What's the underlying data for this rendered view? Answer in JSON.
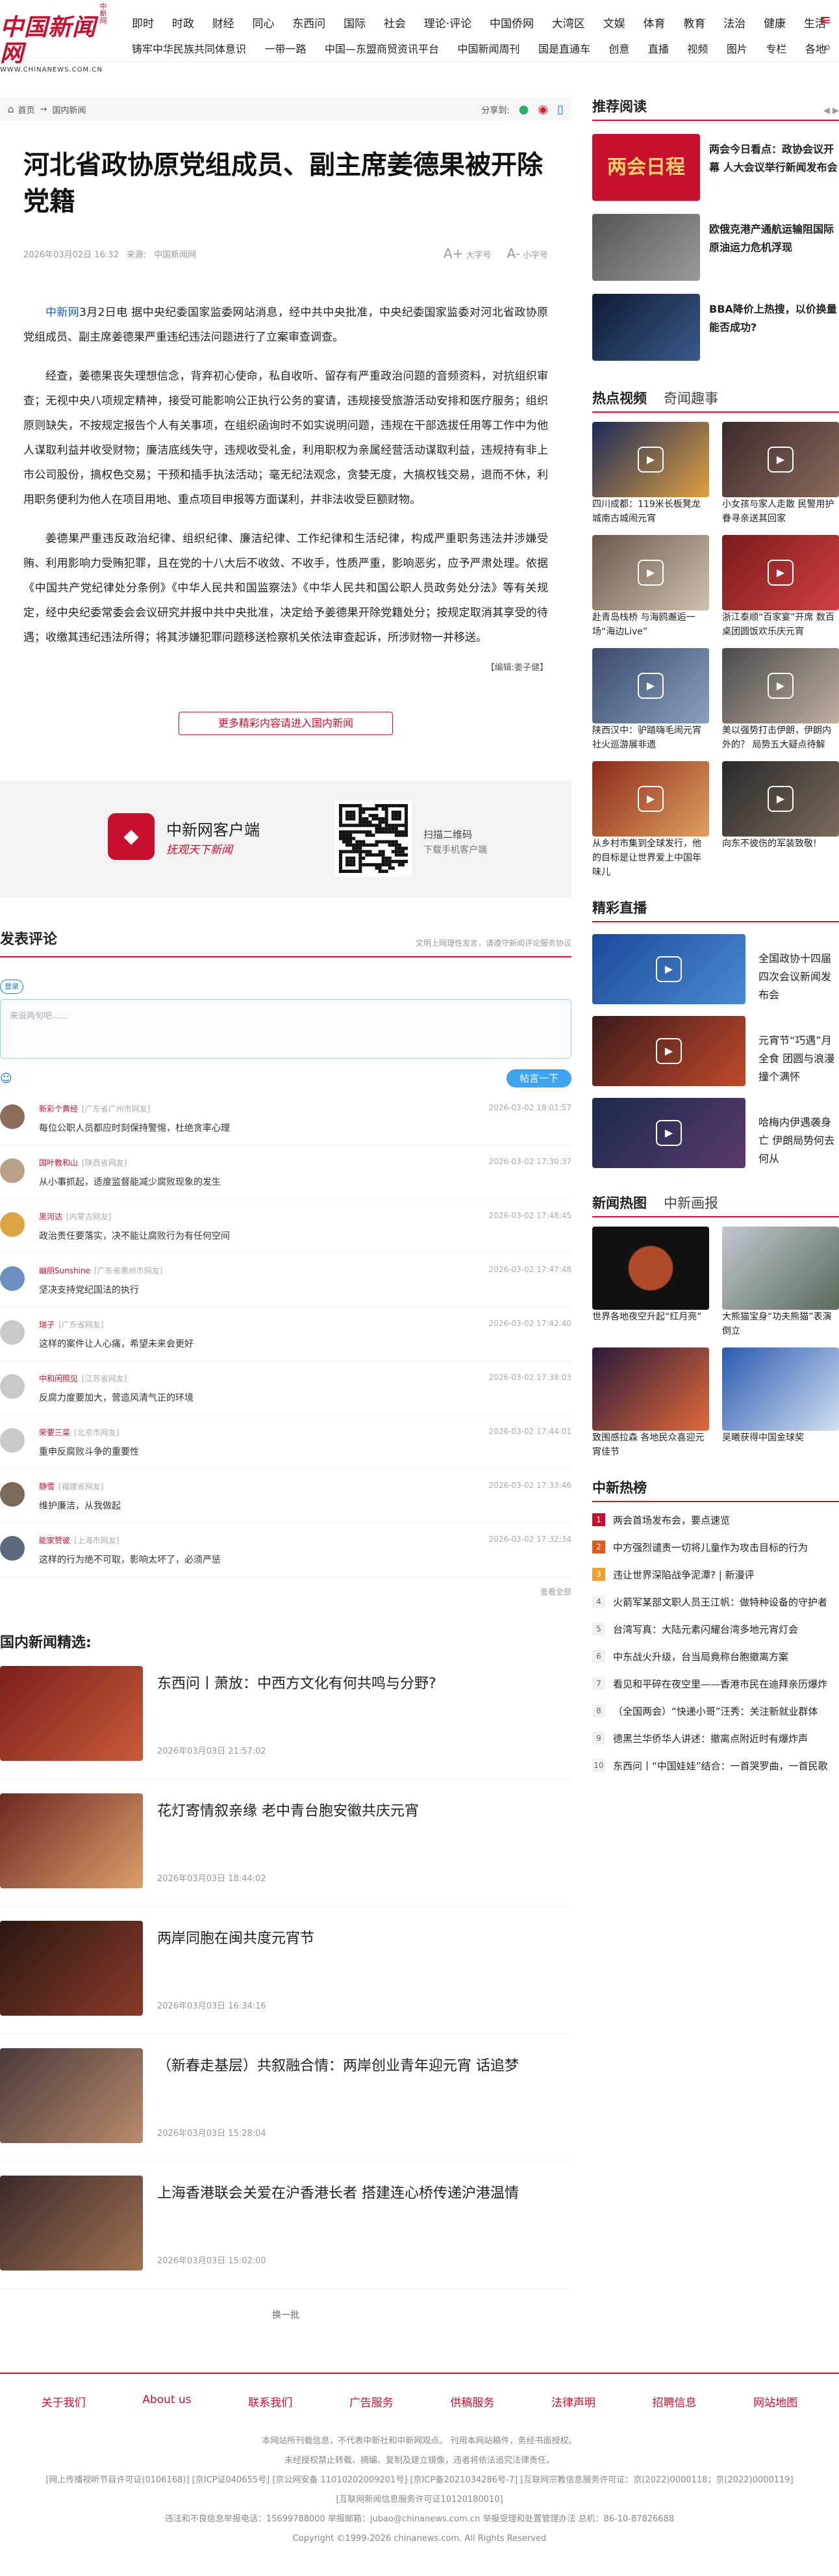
{
  "logo": {
    "cn": "中国新闻网",
    "en": "WWW.CHINANEWS.COM.CN",
    "sub": "中新网"
  },
  "nav": {
    "row1": [
      "即时",
      "时政",
      "财经",
      "国际",
      "社会",
      "理论·评论",
      "中国侨网",
      "大湾区",
      "文娱",
      "体育",
      "教育",
      "法治",
      "健康",
      "生活"
    ],
    "row2": [
      "铸牢中华民族共同体意识",
      "一带一路",
      "中国—东盟商贸资讯平台",
      "中国新闻周刊",
      "国是直通车",
      "创意",
      "直播",
      "视频",
      "图片",
      "专栏",
      "各地"
    ],
    "row1_special": "同心",
    "row1_special2": "东西问"
  },
  "crumb": {
    "home": "首页",
    "section": "国内新闻",
    "share_label": "分享到:"
  },
  "article": {
    "title": "河北省政协原党组成员、副主席姜德果被开除党籍",
    "date": "2026年03月02日 16:32",
    "source_label": "来源:",
    "source": "中国新闻网",
    "font_big": "大字号",
    "font_small": "小字号",
    "p1_src": "中新网",
    "p1": "3月2日电 据中央纪委国家监委网站消息，经中共中央批准，中央纪委国家监委对河北省政协原党组成员、副主席姜德果严重违纪违法问题进行了立案审查调查。",
    "p2": "经查，姜德果丧失理想信念，背弃初心使命，私自收听、留存有严重政治问题的音频资料，对抗组织审查；无视中央八项规定精神，接受可能影响公正执行公务的宴请，违规接受旅游活动安排和医疗服务；组织原则缺失，不按规定报告个人有关事项，在组织函询时不如实说明问题，违规在干部选拔任用等工作中为他人谋取利益并收受财物；廉洁底线失守，违规收受礼金，利用职权为亲属经营活动谋取利益，违规持有非上市公司股份，搞权色交易；干预和插手执法活动；毫无纪法观念，贪婪无度，大搞权钱交易，退而不休，利用职务便利为他人在项目用地、重点项目申报等方面谋利，并非法收受巨额财物。",
    "p3": "姜德果严重违反政治纪律、组织纪律、廉洁纪律、工作纪律和生活纪律，构成严重职务违法并涉嫌受贿、利用影响力受贿犯罪，且在党的十八大后不收敛、不收手，性质严重，影响恶劣，应予严肃处理。依据《中国共产党纪律处分条例》《中华人民共和国监察法》《中华人民共和国公职人员政务处分法》等有关规定，经中央纪委常委会会议研究并报中共中央批准，决定给予姜德果开除党籍处分；按规定取消其享受的待遇；收缴其违纪违法所得；将其涉嫌犯罪问题移送检察机关依法审查起诉，所涉财物一并移送。",
    "editor": "【编辑:姜子健】",
    "more": "更多精彩内容请进入国内新闻"
  },
  "app": {
    "name": "中新网客户端",
    "slogan": "抚观天下新闻",
    "scan1": "扫描二维码",
    "scan2": "下载手机客户端"
  },
  "comments": {
    "title": "发表评论",
    "note": "文明上网理性发言，请遵守新闻评论服务协议",
    "login": "登录",
    "placeholder": "来说两句吧......",
    "post": "帖言一下",
    "more": "查看全部",
    "items": [
      {
        "name": "新彩个黄经",
        "loc": "[广东省广州市网友]",
        "time": "2026-03-02 18:01:57",
        "text": "每位公职人员都应时刻保持警惕，杜绝贪率心理"
      },
      {
        "name": "国叶教和山",
        "loc": "[陕西省网友]",
        "time": "2026-03-02 17:30:37",
        "text": "从小事抓起，适度监督能减少腐败现象的发生"
      },
      {
        "name": "黑河达",
        "loc": "[内蒙古网友]",
        "time": "2026-03-02 17:48:45",
        "text": "政治责任要落实，决不能让腐败行为有任何空间"
      },
      {
        "name": "幽丽Sunshine",
        "loc": "[广东省惠州市网友]",
        "time": "2026-03-02 17:47:48",
        "text": "坚决支持党纪国法的执行"
      },
      {
        "name": "瑞子",
        "loc": "[广东省网友]",
        "time": "2026-03-02 17:42:40",
        "text": "这样的案件让人心痛，希望未来会更好"
      },
      {
        "name": "中和闲照见",
        "loc": "[江苏省网友]",
        "time": "2026-03-02 17:38:03",
        "text": "反腐力度要加大，营造风清气正的环境"
      },
      {
        "name": "荣要三菜",
        "loc": "[北京市网友]",
        "time": "2026-03-02 17:44:01",
        "text": "重申反腐败斗争的重要性"
      },
      {
        "name": "静雪",
        "loc": "[福建省网友]",
        "time": "2026-03-02 17:33:46",
        "text": "维护廉洁，从我做起"
      },
      {
        "name": "能家赞彼",
        "loc": "[上海市网友]",
        "time": "2026-03-02 17:32:34",
        "text": "这样的行为绝不可取，影响太坏了，必须严惩"
      }
    ]
  },
  "selection": {
    "title": "国内新闻精选:",
    "huanyipi": "换一批",
    "items": [
      {
        "title": "东西问丨萧放：中西方文化有何共鸣与分野?",
        "time": "2026年03月03日 21:57:02"
      },
      {
        "title": "花灯寄情叙亲缘 老中青台胞安徽共庆元宵",
        "time": "2026年03月03日 18:44:02"
      },
      {
        "title": "两岸同胞在闽共度元宵节",
        "time": "2026年03月03日 16:34:16"
      },
      {
        "title": "（新春走基层）共叙融合情：两岸创业青年迎元宵 话追梦",
        "time": "2026年03月03日 15:28:04"
      },
      {
        "title": "上海香港联会关爱在沪香港长者 搭建连心桥传递沪港温情",
        "time": "2026年03月03日 15:02:00"
      }
    ]
  },
  "right": {
    "recommend": {
      "title": "推荐阅读",
      "items": [
        {
          "img_text": "两会日程",
          "title": "两会今日看点：政协会议开幕 人大会议举行新闻发布会"
        },
        {
          "img_text": "",
          "title": "欧俄克港产通航运输阻国际原油运力危机浮现"
        },
        {
          "img_text": "",
          "title": "BBA降价上热搜，以价换量能否成功?"
        }
      ]
    },
    "video": {
      "title": "热点视频",
      "tab2": "奇闻趣事",
      "items": [
        "四川成都：119米长板凳龙城南古城闹元宵",
        "小女孩与家人走散 民警用护眷寻亲送其回家",
        "赴青岛栈桥 与海鸥邂逅一场“海边Live”",
        "浙江泰顺“百家宴”开席 数百桌团圆饭欢乐庆元宵",
        "陕西汉中：驴踏嗨毛闹元宵 社火巡游展非遗",
        "美以强势打击伊朗，伊朗内外的？ 局势五大疑点待解",
        "从乡村市集到全球发行，他的目标是让世界爱上中国年味儿",
        "向东不彼伤的军装致敬!"
      ]
    },
    "live": {
      "title": "精彩直播",
      "items": [
        "全国政协十四届四次会议新闻发布会",
        "元宵节“巧遇”月全食 团圆与浪漫撞个满怀",
        "哈梅内伊遇袭身亡 伊朗局势何去何从"
      ]
    },
    "photo": {
      "title": "新闻热图",
      "tab2": "中新画报",
      "items": [
        "世界各地夜空升起“红月亮”",
        "大熊猫宝身“功夫熊猫”表演倒立",
        "致围感拉森 各地民众喜迎元宵佳节",
        "吴曦获得中国金球奖"
      ]
    },
    "rank": {
      "title": "中新热榜",
      "items": [
        "两会首场发布会，要点速览",
        "中方强烈谴责一切将儿童作为攻击目标的行为",
        "违让世界深陷战争泥潭? | 新漫评",
        "火箭军某部文职人员王江帆：做特种设备的守护者",
        "台湾写真：大陆元素闪耀台湾多地元宵灯会",
        "中东战火升级，台当局竟称台胞撤离方案",
        "看见和平碎在夜空里——香港市民在迪拜亲历爆炸",
        "（全国两会）“快递小哥”汪秀：关注新就业群体",
        "德黑兰华侨华人讲述：撤离点附近时有爆炸声",
        "东西问丨“中国娃娃”结合：一首哭罗曲，一首民歌"
      ]
    }
  },
  "footer": {
    "links": [
      "关于我们",
      "About us",
      "联系我们",
      "广告服务",
      "供稿服务",
      "法律声明",
      "招聘信息",
      "网站地图"
    ],
    "l1": "本网站所刊载信息，不代表中新社和中新网观点。 刊用本网站稿件，务经书面授权。",
    "l2": "未经授权禁止转载、摘编、复制及建立镜像，违者将依法追究法律责任。",
    "l3": "[网上传播视听节目许可证(0106168)] [京ICP证040655号] [京公网安备 11010202009201号] [京ICP备2021034286号-7] [互联网宗教信息服务许可证：京(2022)0000118；京(2022)0000119]",
    "l4": "[互联网新闻信息服务许可证10120180010]",
    "l5": "违法和不良信息举报电话：15699788000 举报邮箱：jubao@chinanews.com.cn 举报受理和处置管理办法 总机：86-10-87826688",
    "l6": "Copyright ©1999-2026 chinanews.com. All Rights Reserved"
  },
  "colors": {
    "brand": "#c8102e",
    "link": "#1a5fb4",
    "accent_blue": "#3ea3f0"
  }
}
